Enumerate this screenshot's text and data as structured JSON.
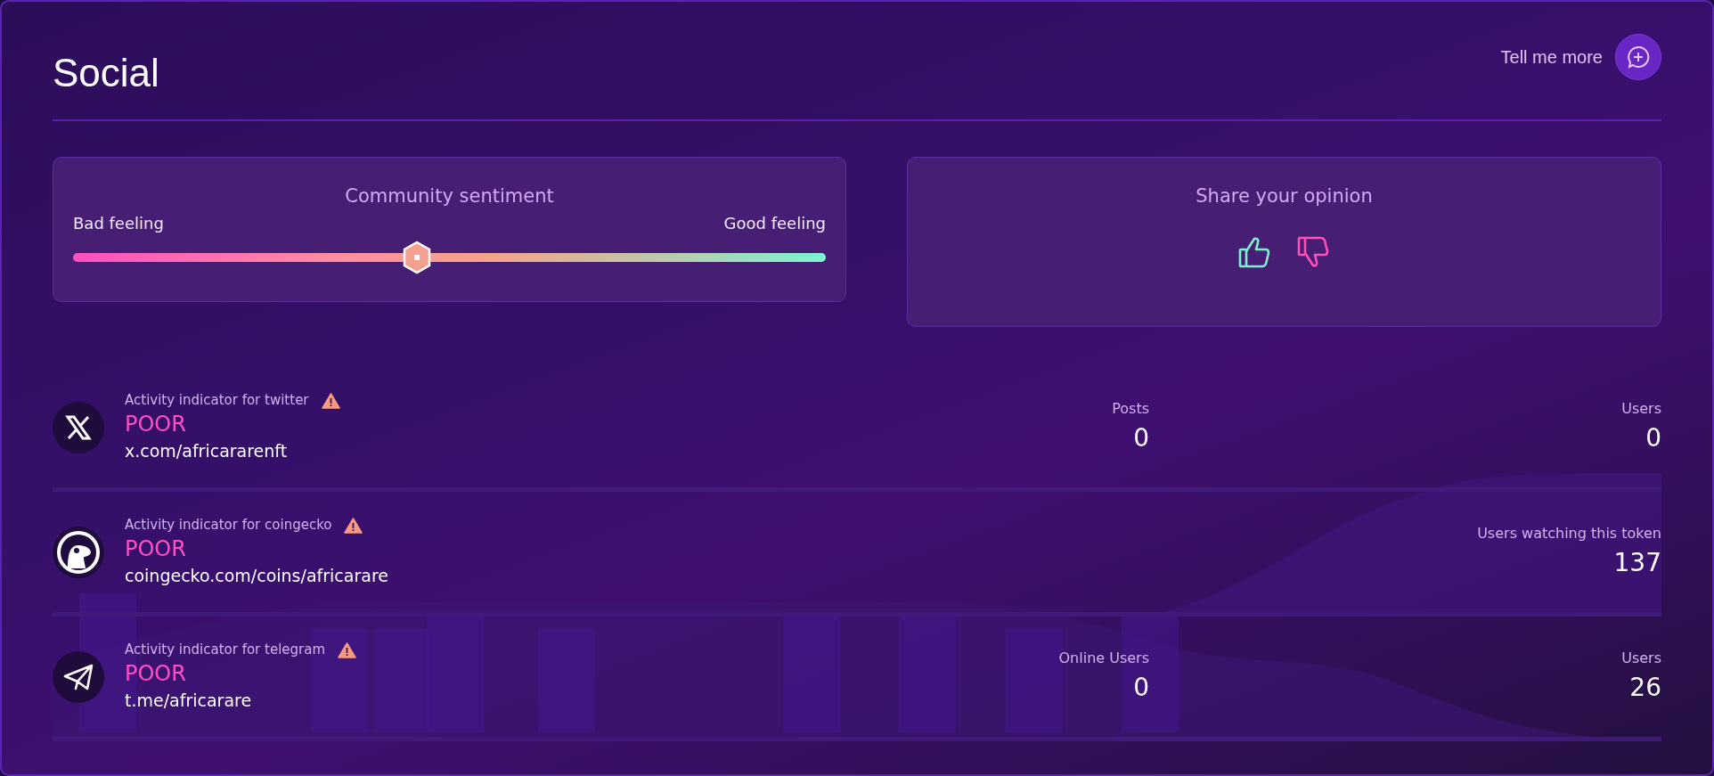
{
  "header": {
    "title": "Social",
    "tell_more": "Tell me more"
  },
  "sentiment": {
    "title": "Community sentiment",
    "left_label": "Bad feeling",
    "right_label": "Good feeling",
    "level": 0.457
  },
  "opinion": {
    "title": "Share your opinion"
  },
  "channels": [
    {
      "kind": "twitter",
      "label": "Activity indicator for twitter",
      "status": "POOR",
      "link": "x.com/africararenft",
      "stats": [
        {
          "label": "Posts",
          "value": "0"
        },
        {
          "label": "Users",
          "value": "0"
        }
      ]
    },
    {
      "kind": "coingecko",
      "label": "Activity indicator for coingecko",
      "status": "POOR",
      "link": "coingecko.com/coins/africarare",
      "stats": [
        {
          "label": "Users watching this token",
          "value": "137"
        }
      ]
    },
    {
      "kind": "telegram",
      "label": "Activity indicator for telegram",
      "status": "POOR",
      "link": "t.me/africarare",
      "stats": [
        {
          "label": "Online Users",
          "value": "0"
        },
        {
          "label": "Users",
          "value": "26"
        }
      ]
    }
  ]
}
